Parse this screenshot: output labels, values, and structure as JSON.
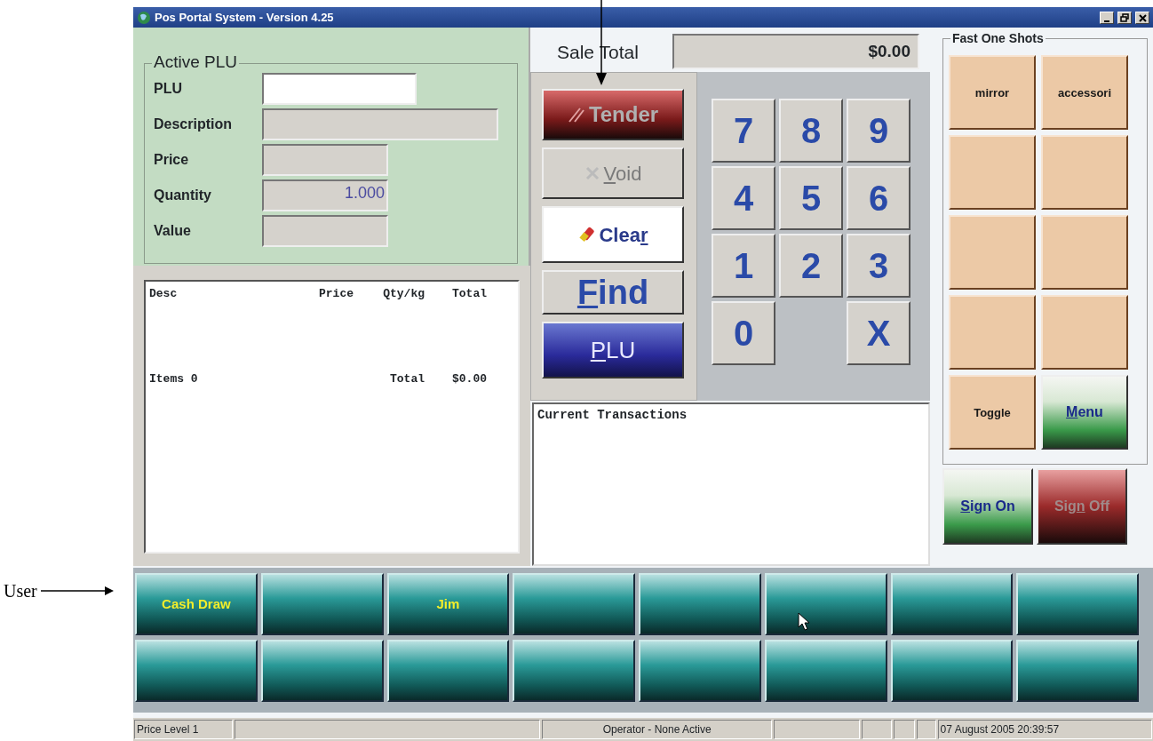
{
  "annotations": [
    {
      "kind": "pointer-label",
      "text": "User"
    },
    {
      "kind": "down-arrow"
    }
  ],
  "window": {
    "title": "Pos Portal System - Version 4.25"
  },
  "active_plu": {
    "title": "Active PLU",
    "fields": [
      {
        "label": "PLU",
        "kind": "input"
      },
      {
        "label": "Description",
        "kind": "wide"
      },
      {
        "label": "Price",
        "kind": "short"
      },
      {
        "label": "Quantity",
        "kind": "short",
        "value": "1.000"
      },
      {
        "label": "Value",
        "kind": "short"
      }
    ]
  },
  "transaction_list": {
    "columns": [
      "Desc",
      "Price",
      "Qty/kg",
      "Total"
    ],
    "items_label": "Items 0",
    "total_label": "Total",
    "total_value": "$0.00"
  },
  "sale_total": {
    "label": "Sale Total",
    "value": "$0.00"
  },
  "actions": [
    {
      "label": "Tender",
      "kind": "tender",
      "disabled": true
    },
    {
      "parts": [
        {
          "text": "V",
          "underlined": true
        },
        {
          "text": "oid",
          "underlined": false
        }
      ],
      "kind": "void",
      "disabled": true
    },
    {
      "parts": [
        {
          "text": "Clea",
          "underlined": false
        },
        {
          "text": "r",
          "underlined": true
        }
      ],
      "kind": "clear",
      "disabled": false
    },
    {
      "parts": [
        {
          "text": "F",
          "underlined": true
        },
        {
          "text": "ind",
          "underlined": false
        }
      ],
      "kind": "find",
      "disabled": false
    },
    {
      "parts": [
        {
          "text": "P",
          "underlined": true
        },
        {
          "text": "LU",
          "underlined": false
        }
      ],
      "kind": "plu",
      "disabled": false
    }
  ],
  "keypad": [
    {
      "kind": "key",
      "label": "7"
    },
    {
      "kind": "key",
      "label": "8"
    },
    {
      "kind": "key",
      "label": "9"
    },
    {
      "kind": "key",
      "label": "4"
    },
    {
      "kind": "key",
      "label": "5"
    },
    {
      "kind": "key",
      "label": "6"
    },
    {
      "kind": "key",
      "label": "1"
    },
    {
      "kind": "key",
      "label": "2"
    },
    {
      "kind": "key",
      "label": "3"
    },
    {
      "kind": "key",
      "label": "0"
    },
    {
      "kind": "gap"
    },
    {
      "kind": "key",
      "label": "X"
    }
  ],
  "current_transactions": {
    "title": "Current Transactions"
  },
  "fast_one_shots": {
    "title": "Fast One Shots",
    "buttons": [
      {
        "kind": "shot",
        "label": "mirror"
      },
      {
        "kind": "shot",
        "label": "accessori"
      },
      {
        "kind": "shot"
      },
      {
        "kind": "shot"
      },
      {
        "kind": "shot"
      },
      {
        "kind": "shot"
      },
      {
        "kind": "shot"
      },
      {
        "kind": "shot"
      },
      {
        "kind": "shot",
        "label": "Toggle"
      },
      {
        "kind": "menu",
        "parts": [
          {
            "text": "M",
            "underlined": true
          },
          {
            "text": "enu",
            "underlined": false
          }
        ]
      }
    ]
  },
  "session_buttons": [
    {
      "kind": "sign-on",
      "parts": [
        {
          "text": "S",
          "underlined": true
        },
        {
          "text": "ign On",
          "underlined": false
        }
      ],
      "disabled": false
    },
    {
      "kind": "sign-off",
      "parts": [
        {
          "text": "Sig",
          "underlined": false
        },
        {
          "text": "n",
          "underlined": true
        },
        {
          "text": " Off",
          "underlined": false
        }
      ],
      "disabled": true
    }
  ],
  "user_buttons": [
    {
      "kind": "user",
      "label": "Cash Draw"
    },
    {
      "kind": "blank"
    },
    {
      "kind": "user",
      "label": "Jim"
    },
    {
      "kind": "blank"
    },
    {
      "kind": "blank"
    },
    {
      "kind": "blank"
    },
    {
      "kind": "blank"
    },
    {
      "kind": "blank"
    },
    {
      "kind": "blank"
    },
    {
      "kind": "blank"
    },
    {
      "kind": "blank"
    },
    {
      "kind": "blank"
    },
    {
      "kind": "blank"
    },
    {
      "kind": "blank"
    },
    {
      "kind": "blank"
    },
    {
      "kind": "blank"
    }
  ],
  "status_bar": [
    {
      "kind": "text",
      "text": "Price Level 1"
    },
    {
      "kind": "empty"
    },
    {
      "kind": "text",
      "text": "Operator - None Active"
    },
    {
      "kind": "empty"
    },
    {
      "kind": "empty"
    },
    {
      "kind": "empty"
    },
    {
      "kind": "empty"
    },
    {
      "kind": "text",
      "text": "07 August 2005 20:39:57"
    }
  ]
}
